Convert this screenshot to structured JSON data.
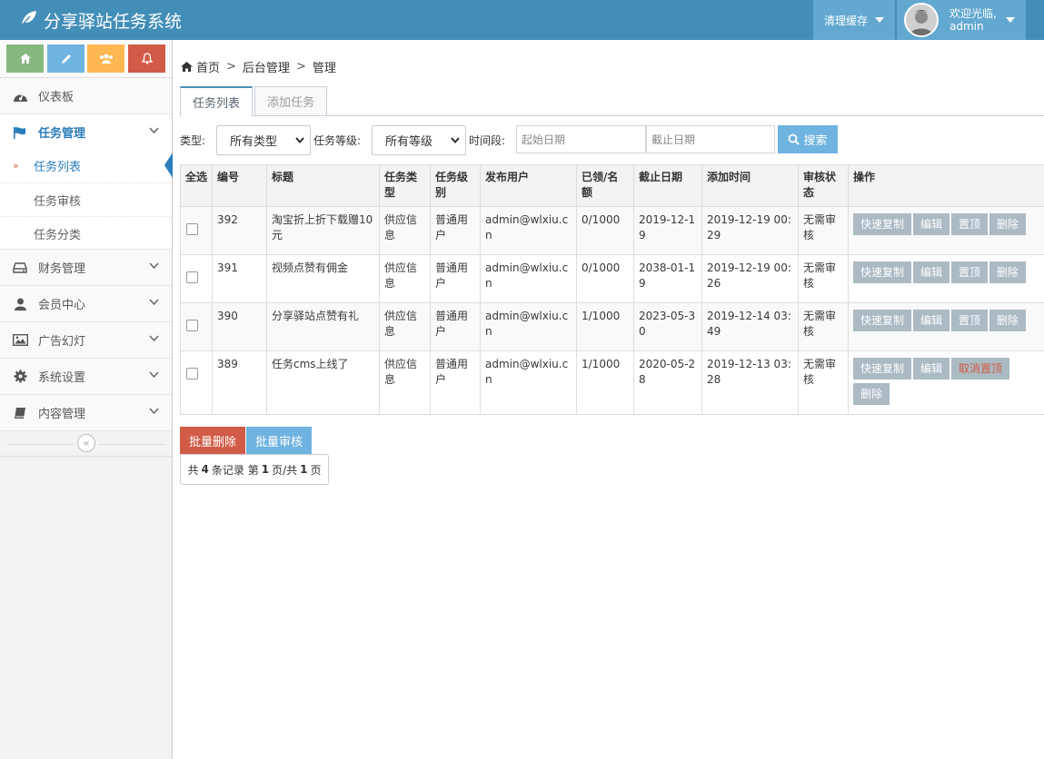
{
  "app": {
    "title": "分享驿站任务系统"
  },
  "navbar": {
    "clear_cache": "清理缓存",
    "welcome": "欢迎光临,",
    "username": "admin"
  },
  "sidebar": {
    "items": [
      {
        "label": "仪表板",
        "icon": "dashboard-icon"
      },
      {
        "label": "任务管理",
        "icon": "flag-icon"
      },
      {
        "label": "财务管理",
        "icon": "hdd-icon"
      },
      {
        "label": "会员中心",
        "icon": "user-icon"
      },
      {
        "label": "广告幻灯",
        "icon": "picture-icon"
      },
      {
        "label": "系统设置",
        "icon": "cog-icon"
      },
      {
        "label": "内容管理",
        "icon": "book-icon"
      }
    ],
    "submenu": [
      "任务列表",
      "任务审核",
      "任务分类"
    ]
  },
  "breadcrumb": [
    "首页",
    "后台管理",
    "管理"
  ],
  "tabs": [
    "任务列表",
    "添加任务"
  ],
  "filter": {
    "type_label": "类型:",
    "type_value": "所有类型",
    "level_label": "任务等级:",
    "level_value": "所有等级",
    "time_label": "时间段:",
    "start_placeholder": "起始日期",
    "end_placeholder": "截止日期",
    "search": "搜索"
  },
  "table": {
    "headers": [
      "全选",
      "编号",
      "标题",
      "任务类型",
      "任务级别",
      "发布用户",
      "已领/名额",
      "截止日期",
      "添加时间",
      "审核状态",
      "操作"
    ],
    "rows": [
      {
        "id": "392",
        "title": "淘宝折上折下载赠10元",
        "type": "供应信息",
        "level": "普通用户",
        "user": "admin@wlxiu.cn",
        "quota": "0/1000",
        "deadline": "2019-12-19",
        "added": "2019-12-19 00:29",
        "status": "无需审核",
        "actions": [
          "快速复制",
          "编辑",
          "置顶",
          "删除"
        ]
      },
      {
        "id": "391",
        "title": "视频点赞有佣金",
        "type": "供应信息",
        "level": "普通用户",
        "user": "admin@wlxiu.cn",
        "quota": "0/1000",
        "deadline": "2038-01-19",
        "added": "2019-12-19 00:26",
        "status": "无需审核",
        "actions": [
          "快速复制",
          "编辑",
          "置顶",
          "删除"
        ]
      },
      {
        "id": "390",
        "title": "分享驿站点赞有礼",
        "type": "供应信息",
        "level": "普通用户",
        "user": "admin@wlxiu.cn",
        "quota": "1/1000",
        "deadline": "2023-05-30",
        "added": "2019-12-14 03:49",
        "status": "无需审核",
        "actions": [
          "快速复制",
          "编辑",
          "置顶",
          "删除"
        ]
      },
      {
        "id": "389",
        "title": "任务cms上线了",
        "type": "供应信息",
        "level": "普通用户",
        "user": "admin@wlxiu.cn",
        "quota": "1/1000",
        "deadline": "2020-05-28",
        "added": "2019-12-13 03:28",
        "status": "无需审核",
        "actions": [
          "快速复制",
          "编辑",
          "取消置顶",
          "删除"
        ]
      }
    ]
  },
  "bulk": {
    "delete": "批量删除",
    "approve": "批量审核"
  },
  "pager": {
    "prefix": "共",
    "total": "4",
    "mid": "条记录 第",
    "page": "1",
    "of": "页/共",
    "pages": "1",
    "suffix": "页"
  },
  "colors": {
    "navbar": "#438eb9",
    "nav_button": "#62a8d1",
    "accent": "#2b7dbc",
    "danger": "#d15b47",
    "info": "#6fb3e0",
    "action_gray": "#abbac3"
  }
}
